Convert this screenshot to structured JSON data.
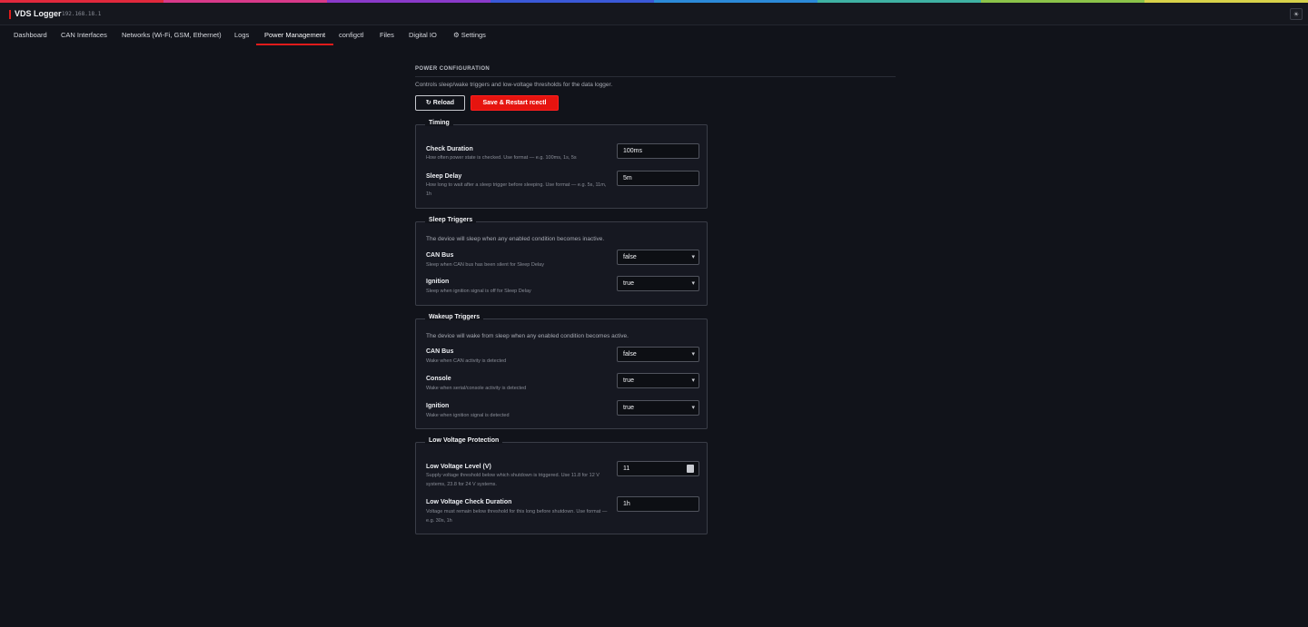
{
  "colors": {
    "accent": "#e01b1b",
    "background": "#11131a",
    "rainbow": [
      "#e0283c",
      "#d83a8a",
      "#8a3ac9",
      "#3a59d8",
      "#2b8ad9",
      "#3fb2a4",
      "#8bc34a",
      "#d8d24a"
    ]
  },
  "header": {
    "title": "VDS Logger",
    "ip": "192.168.18.1",
    "theme_icon": "sun-icon",
    "theme_glyph": "☀"
  },
  "nav": {
    "tabs": [
      "Dashboard",
      "CAN Interfaces",
      "Networks (Wi-Fi, GSM, Ethernet)",
      "Logs",
      "Power Management",
      "configctl",
      "Files",
      "Digital IO",
      "⚙ Settings"
    ],
    "active": "Power Management"
  },
  "page": {
    "section_title": "POWER CONFIGURATION",
    "description": "Controls sleep/wake triggers and low-voltage thresholds for the data logger.",
    "reload_label": "↻ Reload",
    "save_label": "Save & Restart rcectl"
  },
  "timing": {
    "legend": "Timing",
    "check_duration": {
      "label": "Check Duration",
      "help": "How often power state is checked. Use format — e.g. 100ms, 1s, 5s",
      "value": "100ms"
    },
    "sleep_delay": {
      "label": "Sleep Delay",
      "help": "How long to wait after a sleep trigger before sleeping. Use format — e.g. 5s, 11m, 1h",
      "value": "5m"
    }
  },
  "sleep_triggers": {
    "legend": "Sleep Triggers",
    "description": "The device will sleep when any enabled condition becomes inactive.",
    "can_bus": {
      "label": "CAN Bus",
      "help": "Sleep when CAN bus has been silent for Sleep Delay",
      "value": "false"
    },
    "ignition": {
      "label": "Ignition",
      "help": "Sleep when ignition signal is off for Sleep Delay",
      "value": "true"
    }
  },
  "wakeup_triggers": {
    "legend": "Wakeup Triggers",
    "description": "The device will wake from sleep when any enabled condition becomes active.",
    "can_bus": {
      "label": "CAN Bus",
      "help": "Wake when CAN activity is detected",
      "value": "false"
    },
    "console": {
      "label": "Console",
      "help": "Wake when serial/console activity is detected",
      "value": "true"
    },
    "ignition": {
      "label": "Ignition",
      "help": "Wake when ignition signal is detected",
      "value": "true"
    }
  },
  "low_voltage": {
    "legend": "Low Voltage Protection",
    "level": {
      "label": "Low Voltage Level (V)",
      "help": "Supply voltage threshold below which shutdown is triggered. Use 11.8 for 12 V systems, 23.8 for 24 V systems.",
      "value": "11"
    },
    "check_duration": {
      "label": "Low Voltage Check Duration",
      "help": "Voltage must remain below threshold for this long before shutdown. Use format — e.g. 30s, 1h",
      "value": "1h"
    }
  },
  "icons": {
    "chevron": "▾"
  }
}
